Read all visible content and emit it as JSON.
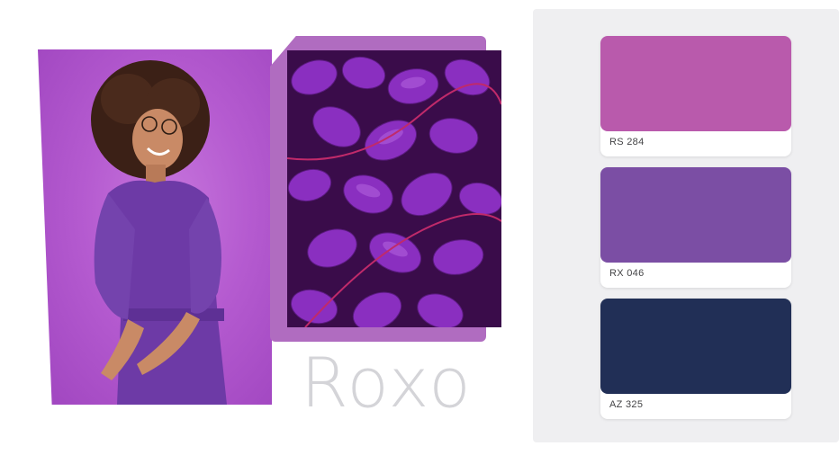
{
  "title": "Roxo",
  "images": [
    {
      "name": "woman-in-purple-dress",
      "background_color": "#b55bd0",
      "dress_color": "#6d3aa6"
    },
    {
      "name": "purple-leaves",
      "background_color": "#3a0c4a",
      "leaf_color": "#8a2fc0"
    }
  ],
  "accent_frame_color": "#b06cc0",
  "swatches": [
    {
      "code": "RS 284",
      "color": "#b95aac"
    },
    {
      "code": "RX 046",
      "color": "#7b4ea4"
    },
    {
      "code": "AZ 325",
      "color": "#212f56"
    }
  ]
}
